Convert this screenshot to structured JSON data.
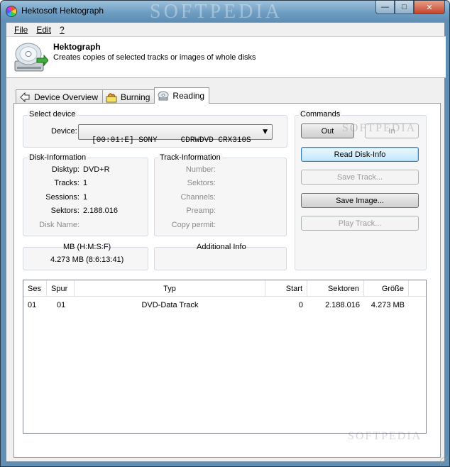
{
  "window": {
    "title": "Hektosoft Hektograph",
    "watermark": "SOFTPEDIA",
    "minimize": "—",
    "maximize": "□",
    "close": "✕"
  },
  "menu": [
    {
      "label": "File"
    },
    {
      "label": "Edit"
    },
    {
      "label": "?"
    }
  ],
  "header": {
    "title": "Hektograph",
    "subtitle": "Creates copies of selected tracks or images of whole disks"
  },
  "tabs": [
    {
      "label": "Device Overview",
      "icon": "back-arrow-icon"
    },
    {
      "label": "Burning",
      "icon": "burn-icon"
    },
    {
      "label": "Reading",
      "icon": "disc-read-icon"
    }
  ],
  "select_device": {
    "group_label": "Select device",
    "device_label": "Device:",
    "device_value": "[00:01:E] SONY     CDRWDVD CRX310S",
    "dropdown_arrow": "▼"
  },
  "commands": {
    "group_label": "Commands",
    "out": "Out",
    "in": "In",
    "read_disk_info": "Read Disk-Info",
    "save_track": "Save Track...",
    "save_image": "Save Image...",
    "play_track": "Play Track..."
  },
  "disk_info": {
    "group_label": "Disk-Information",
    "disktyp_label": "Disktyp:",
    "disktyp_value": "DVD+R",
    "tracks_label": "Tracks:",
    "tracks_value": "1",
    "sessions_label": "Sessions:",
    "sessions_value": "1",
    "sektors_label": "Sektors:",
    "sektors_value": "2.188.016",
    "diskname_label": "Disk Name:"
  },
  "track_info": {
    "group_label": "Track-Information",
    "number_label": "Number:",
    "sektors_label": "Sektors:",
    "channels_label": "Channels:",
    "preamp_label": "Preamp:",
    "copy_permit_label": "Copy permit:"
  },
  "size": {
    "label": "MB (H:M:S:F)",
    "value": "4.273 MB (8:6:13:41)"
  },
  "additional": {
    "label": "Additional Info"
  },
  "table": {
    "columns": [
      "Ses",
      "Spur",
      "Typ",
      "Start",
      "Sektoren",
      "Größe"
    ],
    "rows": [
      [
        "01",
        "01",
        "DVD-Data Track",
        "0",
        "2.188.016",
        "4.273 MB"
      ]
    ]
  }
}
